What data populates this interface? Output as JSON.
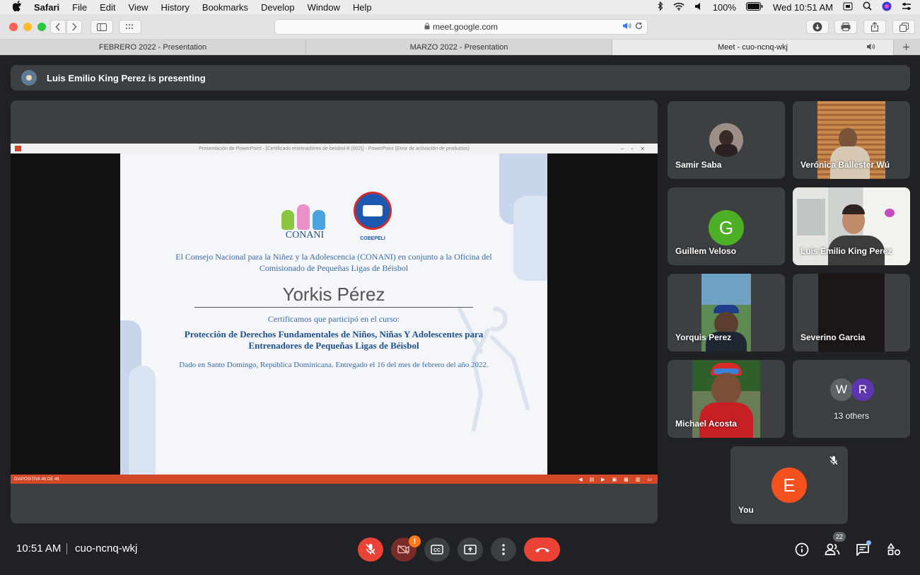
{
  "menubar": {
    "app": "Safari",
    "items": [
      "File",
      "Edit",
      "View",
      "History",
      "Bookmarks",
      "Develop",
      "Window",
      "Help"
    ],
    "battery": "100%",
    "clock": "Wed 10:51 AM"
  },
  "browser": {
    "url": "meet.google.com",
    "tabs": [
      {
        "label": "FEBRERO 2022 - Presentation"
      },
      {
        "label": "MARZO 2022 - Presentation"
      },
      {
        "label": "Meet - cuo-ncnq-wkj"
      }
    ]
  },
  "meet": {
    "presenting_banner": "Luis Emilio King Perez is presenting",
    "ppt_window_title": "Presentación de PowerPoint - [Certificado entrenadores de beisbol-8 (002)] - PowerPoint (Error de activación de productos)",
    "slide": {
      "logo_left": "CONANI",
      "logo_right": "COBEPELI",
      "intro": "El Consejo Nacional para la Niñez y la Adolescencia (CONANI) en conjunto a la Oficina del Comisionado de Pequeñas Ligas de Béisbol",
      "recipient": "Yorkis Pérez",
      "certify": "Certificamos que participó en el curso:",
      "course": "Protección de Derechos Fundamentales de Niños, Niñas Y Adolescentes para Entrenadores de Pequeñas Ligas de Béisbol",
      "given": "Dado en Santo Domingo, República Dominicana. Entregado el 16 del mes de febrero del año 2022."
    },
    "slide_counter": "DIAPOSITIVA 46 DE 46",
    "participants": [
      {
        "name": "Samir Saba"
      },
      {
        "name": "Verónica Ballester Wú"
      },
      {
        "name": "Guillem Veloso",
        "initial": "G"
      },
      {
        "name": "Luis Emilio King Perez"
      },
      {
        "name": "Yorquis Perez"
      },
      {
        "name": "Severino Garcia"
      },
      {
        "name": "Michael Acosta"
      },
      {
        "name": "13 others",
        "initials": [
          "W",
          "R"
        ]
      },
      {
        "name": "You",
        "initial": "E"
      }
    ],
    "colors": {
      "guillem": "#4caf26",
      "you": "#f4511e",
      "w": "#5f6368",
      "r": "#5e35b1",
      "hangup": "#ea4335"
    },
    "time": "10:51 AM",
    "meeting_code": "cuo-ncnq-wkj",
    "people_count": "22",
    "warn_badge": "!"
  }
}
